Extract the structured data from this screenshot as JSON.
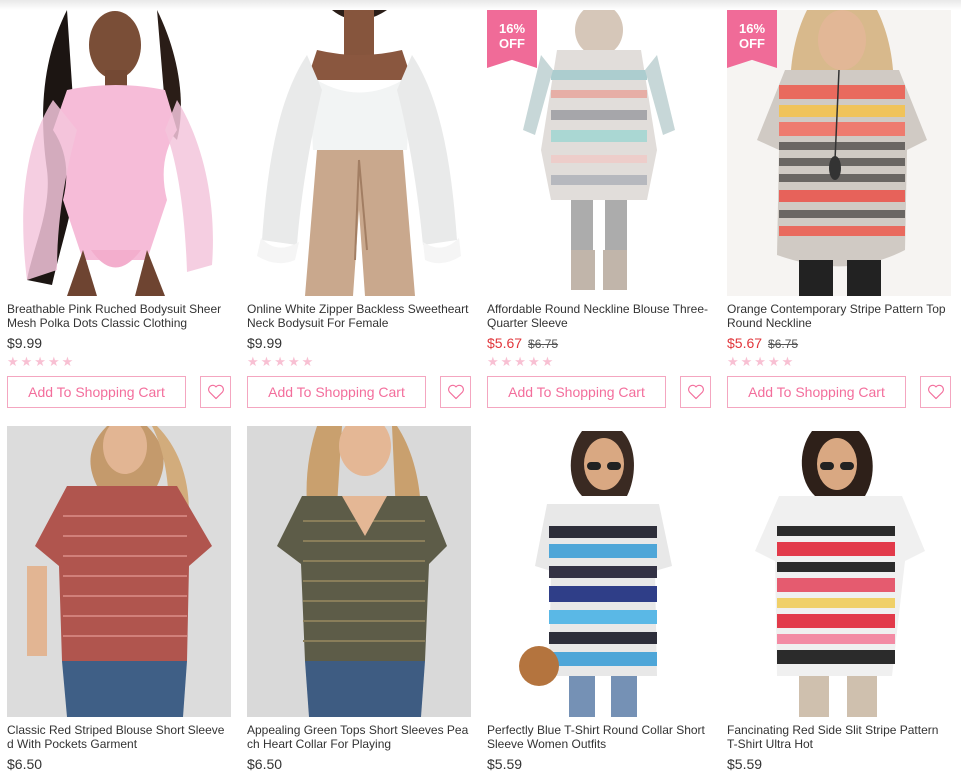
{
  "shop": {
    "cart_label": "Add To Shopping Cart",
    "wish_icon": "heart-outline-icon",
    "star_icon": "star-icon",
    "colors": {
      "accent": "#f36e9c",
      "border": "#f4a6c0",
      "sale": "#e1373c",
      "badge": "#f06b98",
      "star": "#f8c0d3"
    }
  },
  "products": [
    {
      "title": "Breathable Pink Ruched Bodysuit Sheer Mesh Polka Dots Classic Clothing",
      "price": "$9.99",
      "old_price": "",
      "badge_line1": "",
      "badge_line2": "",
      "stars": "★★★★★"
    },
    {
      "title": "Online White Zipper Backless Sweetheart Neck Bodysuit For Female",
      "price": "$9.99",
      "old_price": "",
      "badge_line1": "",
      "badge_line2": "",
      "stars": "★★★★★"
    },
    {
      "title": "Affordable Round Neckline Blouse Three-Quarter Sleeve",
      "price": "$5.67",
      "old_price": "$6.75",
      "badge_line1": "16%",
      "badge_line2": "OFF",
      "stars": "★★★★★"
    },
    {
      "title": "Orange Contemporary Stripe Pattern Top Round Neckline",
      "price": "$5.67",
      "old_price": "$6.75",
      "badge_line1": "16%",
      "badge_line2": "OFF",
      "stars": "★★★★★"
    },
    {
      "title": "Classic Red Striped Blouse Short Sleeve d With Pockets Garment",
      "price": "$6.50"
    },
    {
      "title": "Appealing Green Tops Short Sleeves Pea ch Heart Collar For Playing",
      "price": "$6.50"
    },
    {
      "title": "Perfectly Blue T-Shirt Round Collar Short Sleeve Women Outfits",
      "price": "$5.59"
    },
    {
      "title": "Fancinating Red Side Slit Stripe Pattern T-Shirt Ultra Hot",
      "price": "$5.59"
    }
  ]
}
